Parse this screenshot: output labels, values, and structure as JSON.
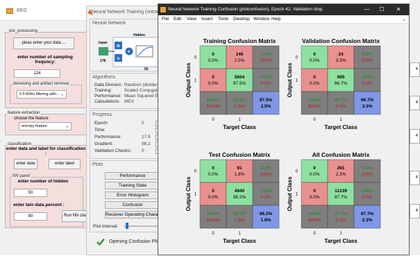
{
  "eeg_window": {
    "title": "EEG",
    "preprocessing": {
      "title": "pre_processing",
      "enter_data_button": "pleas enter your data ...",
      "sampling_label": "enter number of sampling frequncy:",
      "sampling_value": "124",
      "denoising_label": "denoising and artifact removal",
      "filter_selected": "0.5-60Hz filtering with..."
    },
    "feature_extraction": {
      "title": "feature extraction",
      "choose_label": "choose the feature",
      "feature_selected": "entropy feature"
    },
    "classification": {
      "title": "classification",
      "header": "enter data and label for classification :",
      "enter_data_button": "enter data",
      "enter_label_button": "enter label",
      "nn_panel_title": "NN panel",
      "hidden_label": "enter number of hidden",
      "hidden_value": "50",
      "train_percent_label": "enter tain data percent :",
      "train_percent_value": "80",
      "run_button": "Run NN classification"
    }
  },
  "nntraintool": {
    "title": "Neural Network Training (nntraintool)",
    "network_section": "Neural Network",
    "diagram": {
      "hidden": "Hidden",
      "input": "Input",
      "input_size": "178",
      "w": "W",
      "b": "b",
      "hidden_size": "50"
    },
    "algorithms": {
      "title": "Algorithms",
      "rows": [
        {
          "label": "Data Division:",
          "value": "Random  (dividerand)"
        },
        {
          "label": "Training:",
          "value": "Scaled Conjugate Gradient"
        },
        {
          "label": "Performance:",
          "value": "Mean Squared Error"
        },
        {
          "label": "Calculations:",
          "value": "MEX"
        }
      ]
    },
    "progress": {
      "title": "Progress",
      "rows": [
        {
          "label": "Epoch:",
          "value": "0"
        },
        {
          "label": "Time:",
          "value": ""
        },
        {
          "label": "Performance:",
          "value": "17.9"
        },
        {
          "label": "Gradient:",
          "value": "98.2"
        },
        {
          "label": "Validation Checks:",
          "value": "0"
        }
      ]
    },
    "plots": {
      "title": "Plots",
      "buttons": [
        "Performance",
        "Training State",
        "Error Histogram",
        "Confusion",
        "Receiver Operating Characteristic"
      ]
    },
    "plot_interval_label": "Plot Interval:",
    "status": "Opening Confusion Plot"
  },
  "confusion_window": {
    "title": "Neural Network Training Confusion (plotconfusion), Epoch 42, Validation stop.",
    "window_buttons": {
      "minimize": "—",
      "maximize": "☐",
      "close": "✕"
    },
    "menu": [
      "File",
      "Edit",
      "View",
      "Insert",
      "Tools",
      "Desktop",
      "Window",
      "Help"
    ],
    "xlabel": "Target Class",
    "ylabel": "Output Class",
    "colors": {
      "green": "#8ee0a0",
      "red": "#e99090",
      "gray": "#7f7f7f",
      "blue": "#7f97e6",
      "green_text": "#1a8a1a",
      "red_text": "#c01a1a"
    },
    "matrices": [
      {
        "title": "Training Confusion Matrix",
        "cells": [
          [
            "0",
            "0.0%"
          ],
          [
            "146",
            "2.5%"
          ],
          [
            "0.0%",
            "100%"
          ],
          [
            "0",
            "0.0%"
          ],
          [
            "5604",
            "97.5%"
          ],
          [
            "100%",
            "0.0%"
          ],
          [
            "NaN%",
            "NaN%"
          ],
          [
            "97.5%",
            "2.5%"
          ],
          [
            "97.5%",
            "2.5%"
          ]
        ]
      },
      {
        "title": "Validation Confusion Matrix",
        "cells": [
          [
            "0",
            "0.0%"
          ],
          [
            "24",
            "3.3%"
          ],
          [
            "0.0%",
            "100%"
          ],
          [
            "0",
            "0.0%"
          ],
          [
            "695",
            "96.7%"
          ],
          [
            "100%",
            "0.0%"
          ],
          [
            "NaN%",
            "NaN%"
          ],
          [
            "96.7%",
            "3.3%"
          ],
          [
            "96.7%",
            "3.3%"
          ]
        ]
      },
      {
        "title": "Test Confusion Matrix",
        "cells": [
          [
            "0",
            "0.0%"
          ],
          [
            "91",
            "1.8%"
          ],
          [
            "0.0%",
            "100%"
          ],
          [
            "0",
            "0.0%"
          ],
          [
            "4940",
            "98.2%"
          ],
          [
            "100%",
            "0.0%"
          ],
          [
            "NaN%",
            "NaN%"
          ],
          [
            "98.2%",
            "1.8%"
          ],
          [
            "98.2%",
            "1.8%"
          ]
        ]
      },
      {
        "title": "All Confusion Matrix",
        "cells": [
          [
            "0",
            "0.0%"
          ],
          [
            "261",
            "2.3%"
          ],
          [
            "0.0%",
            "100%"
          ],
          [
            "0",
            "0.0%"
          ],
          [
            "11239",
            "97.7%"
          ],
          [
            "100%",
            "0.0%"
          ],
          [
            "NaN%",
            "NaN%"
          ],
          [
            "97.7%",
            "2.3%"
          ],
          [
            "97.7%",
            "2.3%"
          ]
        ]
      }
    ],
    "class_ticks": [
      "0",
      "1"
    ]
  },
  "background_right": {
    "values": [
      "4",
      "4",
      "4",
      "4",
      "4"
    ]
  }
}
